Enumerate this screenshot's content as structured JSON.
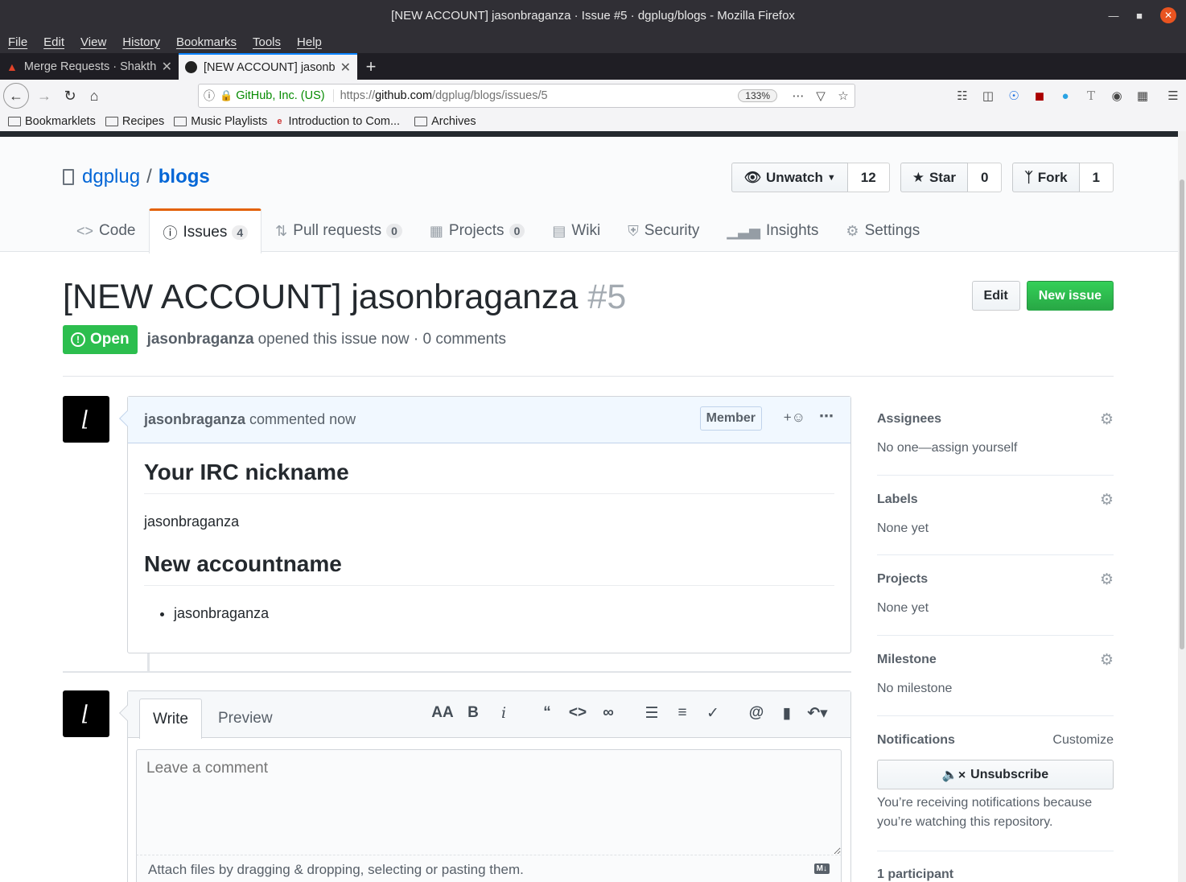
{
  "browser": {
    "window_title": "[NEW ACCOUNT] jasonbraganza · Issue #5 · dgplug/blogs - Mozilla Firefox",
    "menu": [
      "File",
      "Edit",
      "View",
      "History",
      "Bookmarks",
      "Tools",
      "Help"
    ],
    "tabs": [
      {
        "label": "Merge Requests · Shakthi",
        "active": false
      },
      {
        "label": "[NEW ACCOUNT] jasonbraganza",
        "active": true
      }
    ],
    "url_org": "GitHub, Inc. (US)",
    "url_prefix": "https://",
    "url_host": "github.com",
    "url_path": "/dgplug/blogs/issues/5",
    "zoom": "133%",
    "bookmarks": [
      "Bookmarklets",
      "Recipes",
      "Music Playlists",
      "Introduction to Com...",
      "Archives"
    ]
  },
  "repo": {
    "owner": "dgplug",
    "name": "blogs",
    "watch_label": "Unwatch",
    "watch_count": "12",
    "star_label": "Star",
    "star_count": "0",
    "fork_label": "Fork",
    "fork_count": "1"
  },
  "nav": {
    "code": "Code",
    "issues": "Issues",
    "issues_count": "4",
    "pulls": "Pull requests",
    "pulls_count": "0",
    "projects": "Projects",
    "projects_count": "0",
    "wiki": "Wiki",
    "security": "Security",
    "insights": "Insights",
    "settings": "Settings"
  },
  "issue": {
    "title": "[NEW ACCOUNT] jasonbraganza",
    "number": "#5",
    "state": "Open",
    "author": "jasonbraganza",
    "meta_text": "opened this issue now · 0 comments",
    "edit_label": "Edit",
    "new_issue_label": "New issue"
  },
  "comment": {
    "author": "jasonbraganza",
    "time_text": "commented now",
    "role": "Member",
    "heading1": "Your IRC nickname",
    "para1": "jasonbraganza",
    "heading2": "New accountname",
    "list_item": "jasonbraganza"
  },
  "new_comment": {
    "write_tab": "Write",
    "preview_tab": "Preview",
    "placeholder": "Leave a comment",
    "attach_text": "Attach files by dragging & dropping, selecting or pasting them.",
    "md_badge": "M↓"
  },
  "sidebar": {
    "assignees_label": "Assignees",
    "assignees_value": "No one—assign yourself",
    "labels_label": "Labels",
    "labels_value": "None yet",
    "projects_label": "Projects",
    "projects_value": "None yet",
    "milestone_label": "Milestone",
    "milestone_value": "No milestone",
    "notifications_label": "Notifications",
    "customize_label": "Customize",
    "unsubscribe_label": "Unsubscribe",
    "notif_text": "You’re receiving notifications because you’re watching this repository.",
    "participants": "1 participant"
  }
}
